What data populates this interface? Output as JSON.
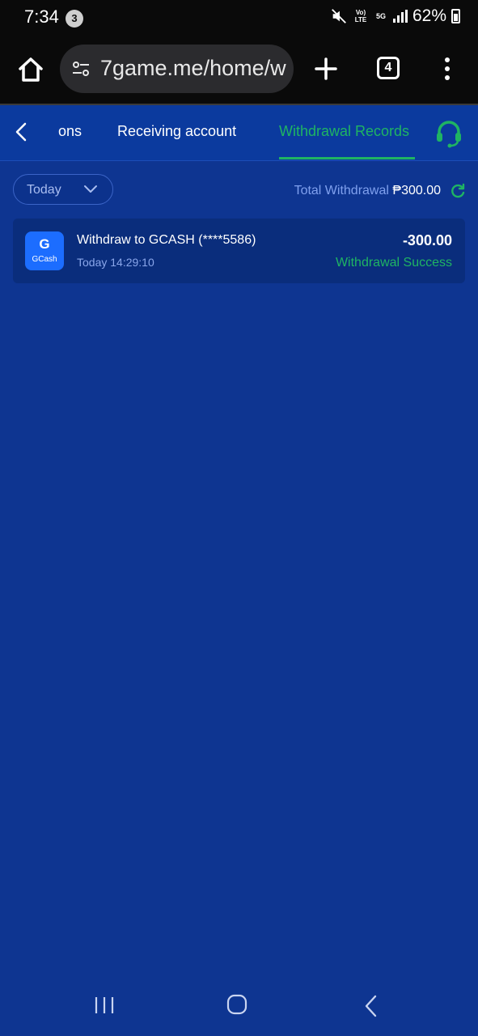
{
  "status_bar": {
    "time": "7:34",
    "notification_count": "3",
    "volte_label": "Vo) LTE",
    "network_label": "5G",
    "battery_percent": "62%"
  },
  "browser": {
    "url": "7game.me/home/w",
    "tab_count": "4"
  },
  "header": {
    "tabs": [
      {
        "label": "ons"
      },
      {
        "label": "Receiving account"
      },
      {
        "label": "Withdrawal Records",
        "active": true
      }
    ]
  },
  "filter": {
    "period": "Today",
    "total_label": "Total Withdrawal",
    "total_amount": "₱300.00"
  },
  "records": [
    {
      "logo_text": "GCash",
      "logo_glyph": "G",
      "title": "Withdraw to GCASH (****5586)",
      "time": "Today 14:29:10",
      "amount": "-300.00",
      "status": "Withdrawal Success"
    }
  ],
  "colors": {
    "background": "#0e3591",
    "accent_green": "#1fb463",
    "card": "#0a2d7c",
    "gcash_blue": "#1c6dff"
  },
  "icons": [
    "home-icon",
    "site-settings-icon",
    "new-tab-icon",
    "more-menu-icon",
    "back-chevron-icon",
    "headset-support-icon",
    "chevron-down-icon",
    "refresh-icon",
    "mute-icon",
    "recents-icon",
    "nav-home-icon",
    "nav-back-icon"
  ]
}
